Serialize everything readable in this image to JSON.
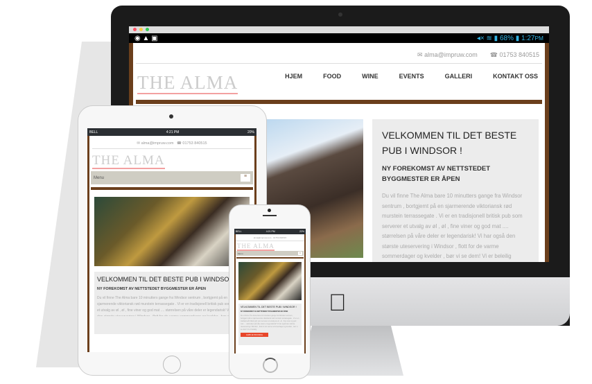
{
  "desktop": {
    "status": {
      "battery": "68%",
      "time": "1:27",
      "ampm": "PM"
    },
    "email": "alma@impruw.com",
    "phone": "01753 840515",
    "logo": "THE ALMA",
    "nav": [
      "HJEM",
      "FOOD",
      "WINE",
      "EVENTS",
      "GALLERI",
      "KONTAKT OSS"
    ],
    "title": "VELKOMMEN TIL DET BESTE PUB I WINDSOR !",
    "subtitle": "NY FOREKOMST AV NETTSTEDET BYGGMESTER ER ÅPEN",
    "body": "Du vil finne The Alma bare 10 minutters gange fra Windsor sentrum , bortgjemt på en sjarmerende viktoriansk rød murstein terrassegate . Vi er en tradisjonell britisk pub som serverer et utvalg av øl , øl , fine viner og god mat .... størrelsen på våre deler er legendarisk! Vi har også den største uteservering i Windsor , flott for de varme sommerdager og kvelder , bør vi se dem! Vi er beleilig"
  },
  "tablet": {
    "carrier": "BELL",
    "time": "4:21 PM",
    "battery": "20%",
    "menu": "Menu"
  },
  "phone": {
    "carrier": "BELL",
    "time": "4:21 PM",
    "battery": "22%",
    "menu": "Menu",
    "button": "GJØR EN BOOKING"
  }
}
